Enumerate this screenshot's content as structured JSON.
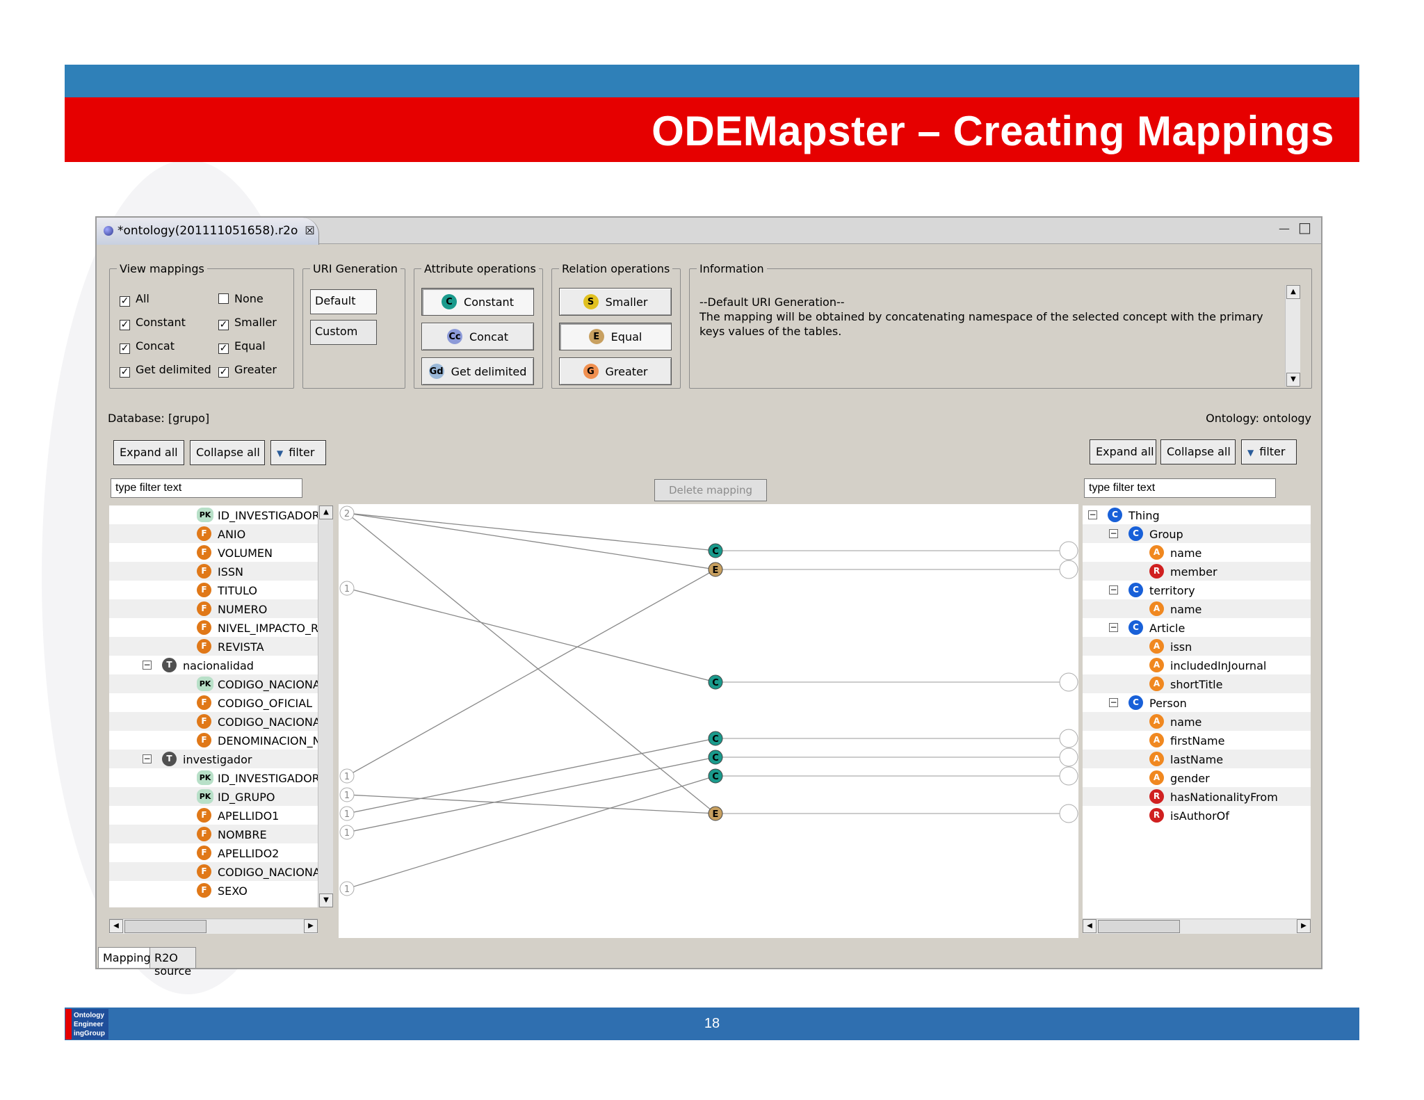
{
  "slide": {
    "title": "ODEMapster – Creating Mappings",
    "page_number": "18",
    "logo_text": [
      "Ontology",
      "Engineer",
      "ingGroup"
    ]
  },
  "editor": {
    "tab_title": "*ontology(201111051658).r2o",
    "close_glyph": "☒",
    "minimize_glyph": "—",
    "maximize_glyph": "□"
  },
  "view_mappings": {
    "legend": "View mappings",
    "items": [
      {
        "label": "All",
        "checked": true
      },
      {
        "label": "None",
        "checked": false
      },
      {
        "label": "Constant",
        "checked": true
      },
      {
        "label": "Smaller",
        "checked": true
      },
      {
        "label": "Concat",
        "checked": true
      },
      {
        "label": "Equal",
        "checked": true
      },
      {
        "label": "Get delimited",
        "checked": true
      },
      {
        "label": "Greater",
        "checked": true
      }
    ]
  },
  "uri_generation": {
    "legend": "URI Generation",
    "default_label": "Default",
    "custom_label": "Custom"
  },
  "attribute_operations": {
    "legend": "Attribute operations",
    "buttons": [
      {
        "icon": "C",
        "label": "Constant"
      },
      {
        "icon": "Cc",
        "label": "Concat"
      },
      {
        "icon": "Gd",
        "label": "Get delimited"
      }
    ]
  },
  "relation_operations": {
    "legend": "Relation operations",
    "buttons": [
      {
        "icon": "S",
        "label": "Smaller"
      },
      {
        "icon": "E",
        "label": "Equal"
      },
      {
        "icon": "G",
        "label": "Greater"
      }
    ]
  },
  "information": {
    "legend": "Information",
    "line1": "--Default URI Generation--",
    "line2": "The mapping will be obtained by concatenating namespace of the selected concept with the primary keys values of the tables."
  },
  "database": {
    "label": "Database: [grupo]",
    "expand_label": "Expand all",
    "collapse_label": "Collapse all",
    "filter_label": "filter",
    "filter_placeholder": "type filter text",
    "rows": [
      {
        "icon": "PK",
        "label": "ID_INVESTIGADOR",
        "level": 2
      },
      {
        "icon": "F",
        "label": "ANIO",
        "level": 2
      },
      {
        "icon": "F",
        "label": "VOLUMEN",
        "level": 2
      },
      {
        "icon": "F",
        "label": "ISSN",
        "level": 2
      },
      {
        "icon": "F",
        "label": "TITULO",
        "level": 2
      },
      {
        "icon": "F",
        "label": "NUMERO",
        "level": 2
      },
      {
        "icon": "F",
        "label": "NIVEL_IMPACTO_REV",
        "level": 2
      },
      {
        "icon": "F",
        "label": "REVISTA",
        "level": 2
      },
      {
        "icon": "T",
        "label": "nacionalidad",
        "level": 1
      },
      {
        "icon": "PK",
        "label": "CODIGO_NACIONALI",
        "level": 2
      },
      {
        "icon": "F",
        "label": "CODIGO_OFICIAL",
        "level": 2
      },
      {
        "icon": "F",
        "label": "CODIGO_NACIONALI",
        "level": 2
      },
      {
        "icon": "F",
        "label": "DENOMINACION_NAC",
        "level": 2
      },
      {
        "icon": "T",
        "label": "investigador",
        "level": 1
      },
      {
        "icon": "PK",
        "label": "ID_INVESTIGADOR",
        "level": 2
      },
      {
        "icon": "PK",
        "label": "ID_GRUPO",
        "level": 2
      },
      {
        "icon": "F",
        "label": "APELLIDO1",
        "level": 2
      },
      {
        "icon": "F",
        "label": "NOMBRE",
        "level": 2
      },
      {
        "icon": "F",
        "label": "APELLIDO2",
        "level": 2
      },
      {
        "icon": "F",
        "label": "CODIGO_NACIONALI",
        "level": 2
      },
      {
        "icon": "F",
        "label": "SEXO",
        "level": 2
      }
    ]
  },
  "ontology": {
    "label": "Ontology: ontology",
    "expand_label": "Expand all",
    "collapse_label": "Collapse all",
    "filter_label": "filter",
    "filter_placeholder": "type filter text",
    "rows": [
      {
        "icon": "C",
        "label": "Thing",
        "level": 0
      },
      {
        "icon": "C",
        "label": "Group",
        "level": 1
      },
      {
        "icon": "A",
        "label": "name",
        "level": 2
      },
      {
        "icon": "R",
        "label": "member",
        "level": 2
      },
      {
        "icon": "C",
        "label": "territory",
        "level": 1
      },
      {
        "icon": "A",
        "label": "name",
        "level": 2
      },
      {
        "icon": "C",
        "label": "Article",
        "level": 1
      },
      {
        "icon": "A",
        "label": "issn",
        "level": 2
      },
      {
        "icon": "A",
        "label": "includedInJournal",
        "level": 2
      },
      {
        "icon": "A",
        "label": "shortTitle",
        "level": 2
      },
      {
        "icon": "C",
        "label": "Person",
        "level": 1
      },
      {
        "icon": "A",
        "label": "name",
        "level": 2
      },
      {
        "icon": "A",
        "label": "firstName",
        "level": 2
      },
      {
        "icon": "A",
        "label": "lastName",
        "level": 2
      },
      {
        "icon": "A",
        "label": "gender",
        "level": 2
      },
      {
        "icon": "R",
        "label": "hasNationalityFrom",
        "level": 2
      },
      {
        "icon": "R",
        "label": "isAuthorOf",
        "level": 2
      }
    ]
  },
  "mapping": {
    "delete_label": "Delete mapping",
    "source_badges": [
      "2",
      "1",
      "1",
      "1",
      "1",
      "1",
      "1"
    ],
    "operators": [
      "C",
      "E",
      "C",
      "C",
      "C",
      "C",
      "E"
    ]
  },
  "bottom_tabs": [
    "Mapping",
    "R2O source"
  ],
  "colors": {
    "title_red": "#e60000",
    "band_blue": "#2f80b8",
    "footer_blue": "#2f6fb0",
    "constant": "#1a9a8c",
    "equal": "#c8a060"
  }
}
